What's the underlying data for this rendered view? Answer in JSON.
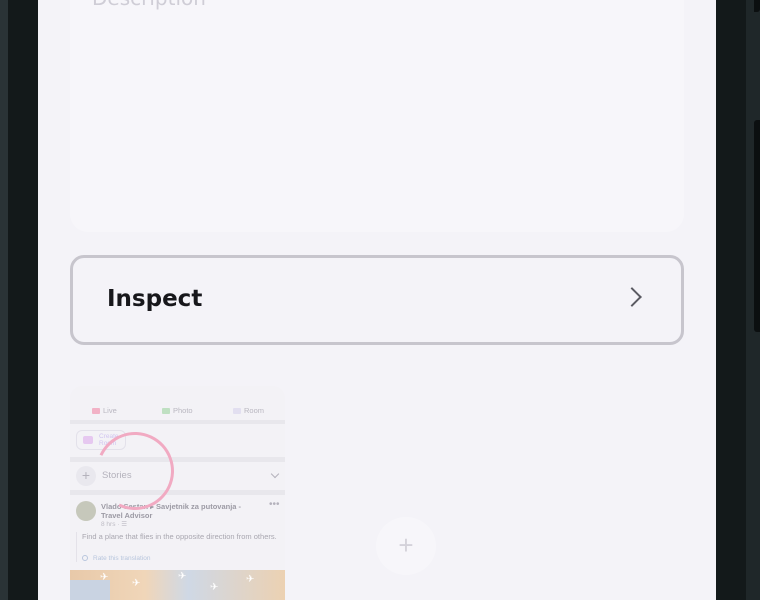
{
  "description": {
    "placeholder": "Description"
  },
  "inspect": {
    "label": "Inspect"
  },
  "thumbnail": {
    "toolbar": {
      "live": "Live",
      "photo": "Photo",
      "room": "Room"
    },
    "create_room": "Create Room",
    "stories": "Stories",
    "post": {
      "author": "Vlado Sestan ▸ Savjetnik za putovanja - Travel Advisor",
      "meta": "8 hrs · ☰",
      "text": "Find a plane that flies in the opposite direction from others.",
      "rate_translation": "Rate this translation"
    }
  },
  "add_button": {
    "symbol": "+"
  },
  "colors": {
    "accent_spinner": "#f1aac2",
    "button_border": "#c7c5cd",
    "screen_bg": "#f4f3f8"
  }
}
